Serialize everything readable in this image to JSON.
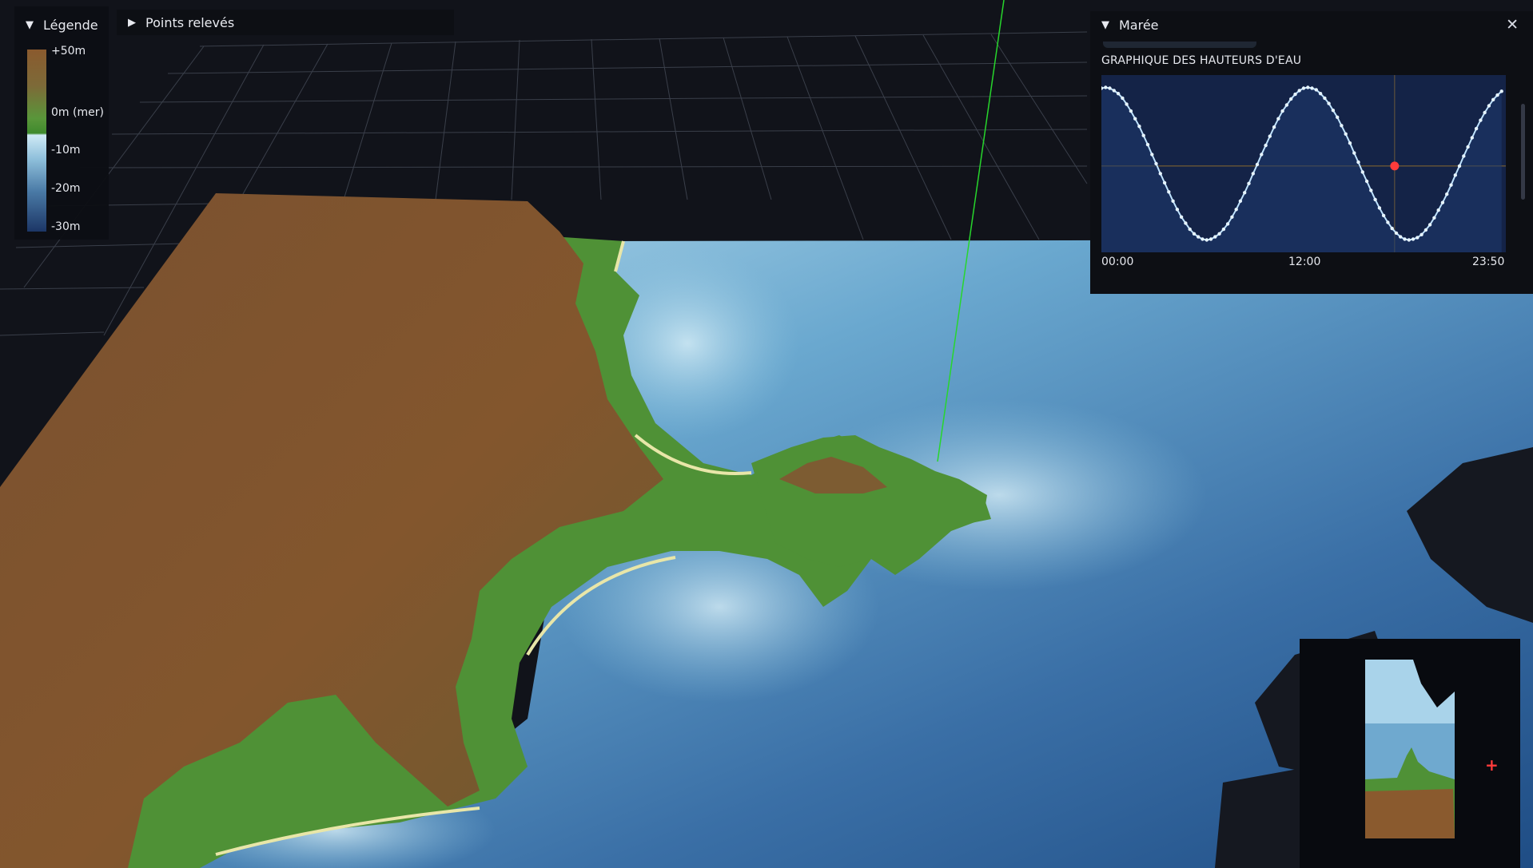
{
  "legend": {
    "title": "Légende",
    "stops": [
      "+50m",
      "0m (mer)",
      "-10m",
      "-20m",
      "-30m"
    ]
  },
  "points_panel": {
    "title": "Points relevés",
    "state": "collapsed"
  },
  "tide_panel": {
    "title": "Marée",
    "chart_title": "GRAPHIQUE DES HAUTEURS D'EAU",
    "close_icon": "close-icon"
  },
  "chart_data": {
    "type": "line",
    "title": "GRAPHIQUE DES HAUTEURS D'EAU",
    "xlabel": "",
    "ylabel": "",
    "x_ticks": [
      "00:00",
      "12:00",
      "23:50"
    ],
    "x": [
      0,
      0.25,
      0.5,
      0.75,
      1,
      1.25,
      1.5,
      1.75,
      2,
      2.25,
      2.5,
      2.75,
      3,
      3.25,
      3.5,
      3.75,
      4,
      4.25,
      4.5,
      4.75,
      5,
      5.25,
      5.5,
      5.75,
      6,
      6.25,
      6.5,
      6.75,
      7,
      7.25,
      7.5,
      7.75,
      8,
      8.25,
      8.5,
      8.75,
      9,
      9.25,
      9.5,
      9.75,
      10,
      10.25,
      10.5,
      10.75,
      11,
      11.25,
      11.5,
      11.75,
      12,
      12.25,
      12.5,
      12.75,
      13,
      13.25,
      13.5,
      13.75,
      14,
      14.25,
      14.5,
      14.75,
      15,
      15.25,
      15.5,
      15.75,
      16,
      16.25,
      16.5,
      16.75,
      17,
      17.25,
      17.5,
      17.75,
      18,
      18.25,
      18.5,
      18.75,
      19,
      19.25,
      19.5,
      19.75,
      20,
      20.25,
      20.5,
      20.75,
      21,
      21.25,
      21.5,
      21.75,
      22,
      22.25,
      22.5,
      22.75,
      23,
      23.25,
      23.5,
      23.75
    ],
    "series": [
      {
        "values": [
          0.99,
          1.0,
          0.99,
          0.96,
          0.92,
          0.86,
          0.78,
          0.69,
          0.59,
          0.49,
          0.37,
          0.25,
          0.12,
          0.0,
          -0.13,
          -0.25,
          -0.37,
          -0.49,
          -0.6,
          -0.7,
          -0.78,
          -0.86,
          -0.92,
          -0.96,
          -0.99,
          -1.0,
          -0.99,
          -0.96,
          -0.92,
          -0.86,
          -0.79,
          -0.7,
          -0.6,
          -0.49,
          -0.38,
          -0.26,
          -0.13,
          -0.01,
          0.12,
          0.24,
          0.36,
          0.48,
          0.59,
          0.69,
          0.77,
          0.85,
          0.91,
          0.96,
          0.99,
          1.0,
          0.99,
          0.97,
          0.92,
          0.86,
          0.79,
          0.7,
          0.61,
          0.5,
          0.39,
          0.27,
          0.14,
          0.02,
          -0.11,
          -0.23,
          -0.35,
          -0.47,
          -0.58,
          -0.68,
          -0.77,
          -0.85,
          -0.91,
          -0.96,
          -0.99,
          -1.0,
          -0.99,
          -0.97,
          -0.93,
          -0.87,
          -0.8,
          -0.71,
          -0.61,
          -0.51,
          -0.4,
          -0.28,
          -0.15,
          -0.03,
          0.1,
          0.22,
          0.34,
          0.46,
          0.57,
          0.67,
          0.76,
          0.84,
          0.9,
          0.95
        ]
      }
    ],
    "current_point": {
      "x": 17.4,
      "y": -0.03
    },
    "ylim": [
      -1.1,
      1.1
    ],
    "grid": false
  },
  "colors": {
    "land_brown": "#8a5a2e",
    "land_green": "#4f9136",
    "shallow_water": "#cfe9f5",
    "deep_water": "#1c3666",
    "chart_line": "#bfe3ff",
    "chart_background": "#142347",
    "current_marker": "#ff3b3b",
    "direction_line": "#27d62c"
  },
  "minimap": {
    "marker": "+"
  }
}
